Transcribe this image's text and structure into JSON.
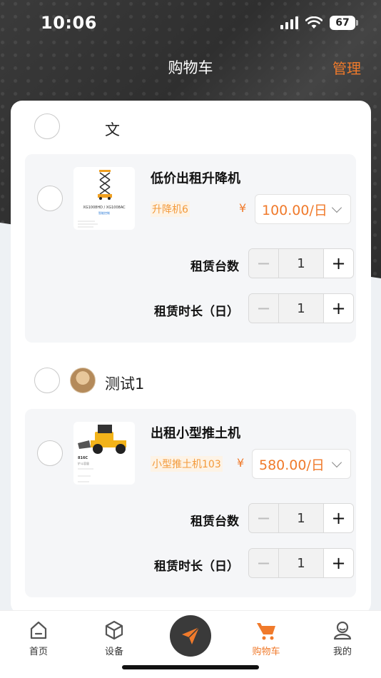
{
  "status": {
    "time": "10:06",
    "battery": "67"
  },
  "nav": {
    "title": "购物车",
    "action": "管理"
  },
  "shops": [
    {
      "name": "文",
      "item": {
        "title": "低价出租升降机",
        "spec": "升降机6",
        "currency": "¥",
        "price": "100.00/日",
        "thumb_caption": "XG1008HD / XG1008AC",
        "thumb_sub": "智能控制",
        "qty_label": "租赁台数",
        "qty_value": "1",
        "duration_label": "租赁时长（日）",
        "duration_value": "1"
      }
    },
    {
      "name": "测试1",
      "item": {
        "title": "出租小型推土机",
        "spec": "小型推土机103",
        "currency": "¥",
        "price": "580.00/日",
        "thumb_caption": "816C",
        "thumb_sub": "铲斗容量",
        "qty_label": "租赁台数",
        "qty_value": "1",
        "duration_label": "租赁时长（日）",
        "duration_value": "1"
      }
    }
  ],
  "stepper": {
    "minus": "−",
    "plus": "+"
  },
  "tabs": [
    {
      "label": "首页",
      "icon": "home-icon"
    },
    {
      "label": "设备",
      "icon": "cube-icon"
    },
    {
      "label": "",
      "icon": "paper-plane-icon"
    },
    {
      "label": "购物车",
      "icon": "cart-icon"
    },
    {
      "label": "我的",
      "icon": "user-icon"
    }
  ],
  "colors": {
    "accent": "#f07a2b",
    "dark": "#3a3a3a",
    "tag_bg": "#fdf3e6"
  }
}
